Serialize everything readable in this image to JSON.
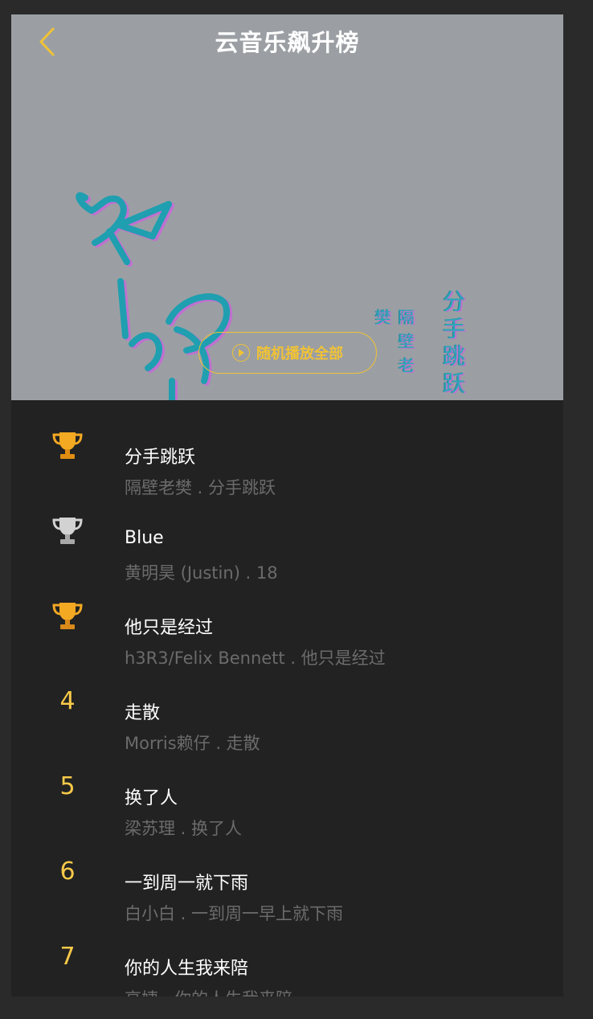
{
  "header": {
    "title": "云音乐飙升榜"
  },
  "cover": {
    "vertical_title": "分手跳跃",
    "vertical_artist": "隔壁老樊"
  },
  "play_all_label": "随机播放全部",
  "colors": {
    "accent": "#f0c236",
    "gold": "#f4a922",
    "silver": "#c8c8c8",
    "bg": "#222222"
  },
  "songs": [
    {
      "rank": "",
      "rank_icon": "trophy-gold",
      "name": "分手跳跃",
      "meta": "隔壁老樊 . 分手跳跃"
    },
    {
      "rank": "",
      "rank_icon": "trophy-silver",
      "name": "Blue",
      "meta": "黄明昊 (Justin) . 18"
    },
    {
      "rank": "",
      "rank_icon": "trophy-bronze",
      "name": "他只是经过",
      "meta": "h3R3/Felix Bennett . 他只是经过"
    },
    {
      "rank": "4",
      "name": "走散",
      "meta": "Morris赖仔 . 走散"
    },
    {
      "rank": "5",
      "name": "换了人",
      "meta": "梁苏理 . 换了人"
    },
    {
      "rank": "6",
      "name": "一到周一就下雨",
      "meta": "白小白 . 一到周一早上就下雨"
    },
    {
      "rank": "7",
      "name": "你的人生我来陪",
      "meta": "高姨 . 你的人生我来陪"
    }
  ]
}
